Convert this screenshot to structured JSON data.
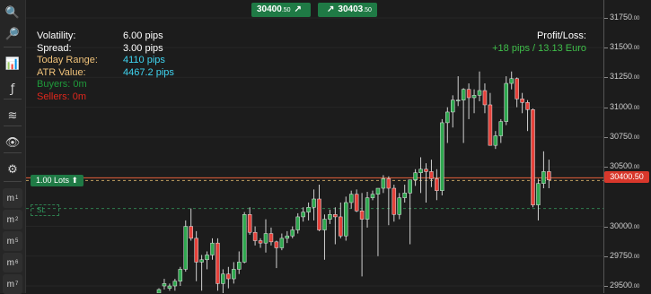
{
  "toolbar": [
    {
      "name": "zoom-in-icon",
      "glyph": "🔍"
    },
    {
      "name": "zoom-out-icon",
      "glyph": "🔎"
    },
    {
      "name": "candlestick-icon",
      "glyph": "📊"
    },
    {
      "name": "indicator-icon",
      "glyph": "ƒ"
    },
    {
      "name": "layers-icon",
      "glyph": "≋"
    },
    {
      "name": "eye-icon",
      "glyph": "👁"
    },
    {
      "name": "settings-chart-icon",
      "glyph": "⚙"
    }
  ],
  "timeframes": [
    "m1",
    "m2",
    "m5",
    "m6",
    "m7"
  ],
  "quotes": {
    "sell_main": "30400",
    "sell_frac": ".50",
    "buy_main": "30403",
    "buy_frac": ".50"
  },
  "stats": [
    {
      "label": "Volatility:",
      "value": "6.00 pips",
      "label_color": "#ffffff",
      "value_color": "#ffffff"
    },
    {
      "label": "Spread:",
      "value": "3.00 pips",
      "label_color": "#ffffff",
      "value_color": "#ffffff"
    },
    {
      "label": "Today Range:",
      "value": "4110 pips",
      "label_color": "#f0c27a",
      "value_color": "#3fd4f0"
    },
    {
      "label": "ATR Value:",
      "value": "4467.2 pips",
      "label_color": "#f0c27a",
      "value_color": "#3fd4f0"
    },
    {
      "label": "Buyers: 0m",
      "value": "",
      "label_color": "#1f9a3b",
      "value_color": "#1f9a3b"
    },
    {
      "label": "Sellers: 0m",
      "value": "",
      "label_color": "#e0271c",
      "value_color": "#e0271c"
    }
  ],
  "profit_loss": {
    "label": "Profit/Loss:",
    "value": "+18 pips /  13.13 Euro",
    "color": "#3fbf4a"
  },
  "lot_badge": "1.00 Lots ⬆",
  "sl_badge": "SL",
  "price_badge": "30400.50",
  "yaxis": [
    {
      "main": "31750",
      "frac": ".00",
      "v": 31750
    },
    {
      "main": "31500",
      "frac": ".00",
      "v": 31500
    },
    {
      "main": "31250",
      "frac": ".00",
      "v": 31250
    },
    {
      "main": "31000",
      "frac": ".00",
      "v": 31000
    },
    {
      "main": "30750",
      "frac": ".00",
      "v": 30750
    },
    {
      "main": "30500",
      "frac": ".00",
      "v": 30500
    },
    {
      "main": "30000",
      "frac": ".00",
      "v": 30000
    },
    {
      "main": "29750",
      "frac": ".00",
      "v": 29750
    },
    {
      "main": "29500",
      "frac": ".00",
      "v": 29500
    }
  ],
  "colors": {
    "up": "#2fa84f",
    "down": "#e5413a",
    "bg": "#1c1c1c",
    "order_line": "#e5603a",
    "sl_line": "#2e7d4e"
  },
  "chart_data": {
    "type": "candlestick",
    "current_price": 30400.5,
    "order_price": 30400.5,
    "sl_price": 30150,
    "ylim": [
      29440,
      31900
    ],
    "candles": [
      [
        29440,
        29480,
        29440,
        29470
      ],
      [
        29500,
        29560,
        29470,
        29520
      ],
      [
        29480,
        29520,
        29460,
        29500
      ],
      [
        29500,
        29560,
        29460,
        29540
      ],
      [
        29540,
        29660,
        29500,
        29640
      ],
      [
        29640,
        30050,
        29620,
        30000
      ],
      [
        30000,
        30150,
        29880,
        29900
      ],
      [
        29900,
        29960,
        29540,
        29700
      ],
      [
        29700,
        29760,
        29460,
        29720
      ],
      [
        29720,
        29790,
        29640,
        29760
      ],
      [
        29760,
        29900,
        29720,
        29860
      ],
      [
        29860,
        29900,
        29460,
        29520
      ],
      [
        29520,
        29640,
        29440,
        29600
      ],
      [
        29600,
        29660,
        29480,
        29560
      ],
      [
        29560,
        29700,
        29520,
        29640
      ],
      [
        29640,
        29790,
        29600,
        29700
      ],
      [
        29700,
        30120,
        29690,
        30100
      ],
      [
        30100,
        30160,
        29930,
        29950
      ],
      [
        29950,
        30000,
        29840,
        29880
      ],
      [
        29880,
        29900,
        29820,
        29860
      ],
      [
        29860,
        30060,
        29780,
        29940
      ],
      [
        29940,
        29990,
        29840,
        29870
      ],
      [
        29870,
        29880,
        29650,
        29820
      ],
      [
        29820,
        29940,
        29800,
        29900
      ],
      [
        29900,
        29960,
        29860,
        29920
      ],
      [
        29920,
        30000,
        29900,
        29970
      ],
      [
        29970,
        30110,
        29940,
        30080
      ],
      [
        30080,
        30160,
        30040,
        30120
      ],
      [
        30120,
        30200,
        30050,
        30160
      ],
      [
        30160,
        30310,
        30050,
        30230
      ],
      [
        30230,
        30350,
        29960,
        29970
      ],
      [
        29970,
        30100,
        29720,
        30060
      ],
      [
        30060,
        30140,
        30020,
        30100
      ],
      [
        30100,
        30160,
        29850,
        30080
      ],
      [
        30080,
        30200,
        29900,
        29920
      ],
      [
        29920,
        30250,
        29880,
        30200
      ],
      [
        30200,
        30300,
        30150,
        30270
      ],
      [
        30270,
        30310,
        30120,
        30130
      ],
      [
        30130,
        30280,
        29580,
        30060
      ],
      [
        30060,
        30290,
        29990,
        30240
      ],
      [
        30240,
        30300,
        30220,
        30270
      ],
      [
        30270,
        30300,
        29750,
        30320
      ],
      [
        30320,
        30430,
        30280,
        30400
      ],
      [
        30400,
        30420,
        30010,
        30320
      ],
      [
        30320,
        30350,
        30040,
        30100
      ],
      [
        30100,
        30280,
        30060,
        30240
      ],
      [
        30240,
        30350,
        30200,
        30280
      ],
      [
        30280,
        30360,
        29850,
        30390
      ],
      [
        30390,
        30480,
        30340,
        30450
      ],
      [
        30450,
        30580,
        30280,
        30480
      ],
      [
        30480,
        30530,
        30200,
        30460
      ],
      [
        30460,
        30560,
        30330,
        30400
      ],
      [
        30400,
        30480,
        30220,
        30300
      ],
      [
        30300,
        30900,
        30260,
        30870
      ],
      [
        30870,
        31000,
        30700,
        30960
      ],
      [
        30960,
        31100,
        30830,
        31060
      ],
      [
        31060,
        31260,
        31010,
        31060
      ],
      [
        31060,
        31160,
        30700,
        31150
      ],
      [
        31150,
        31200,
        30900,
        31080
      ],
      [
        31080,
        31150,
        30950,
        31100
      ],
      [
        31100,
        31300,
        31050,
        31140
      ],
      [
        31140,
        31200,
        30950,
        31020
      ],
      [
        31020,
        31120,
        30680,
        30680
      ],
      [
        30680,
        30800,
        30650,
        30760
      ],
      [
        30760,
        30900,
        30700,
        30880
      ],
      [
        30880,
        31260,
        30850,
        31200
      ],
      [
        31200,
        31300,
        31150,
        31240
      ],
      [
        31240,
        31250,
        31000,
        31070
      ],
      [
        31070,
        31120,
        30950,
        31040
      ],
      [
        31040,
        31060,
        30800,
        30980
      ],
      [
        30980,
        30990,
        30160,
        30180
      ],
      [
        30180,
        30400,
        30050,
        30360
      ],
      [
        30360,
        30630,
        30320,
        30460
      ],
      [
        30460,
        30560,
        30320,
        30390
      ]
    ]
  }
}
